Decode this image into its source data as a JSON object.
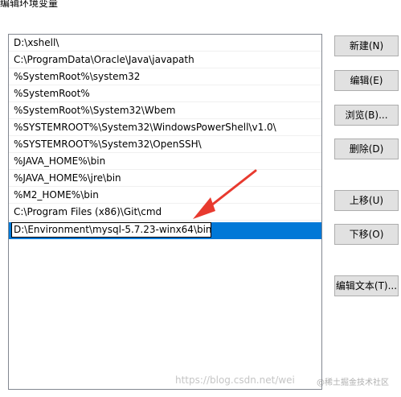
{
  "window": {
    "title": "编辑环境变量"
  },
  "path_list": {
    "items": [
      "D:\\xshell\\",
      "C:\\ProgramData\\Oracle\\Java\\javapath",
      "%SystemRoot%\\system32",
      "%SystemRoot%",
      "%SystemRoot%\\System32\\Wbem",
      "%SYSTEMROOT%\\System32\\WindowsPowerShell\\v1.0\\",
      "%SYSTEMROOT%\\System32\\OpenSSH\\",
      "%JAVA_HOME%\\bin",
      "%JAVA_HOME%\\jre\\bin",
      "%M2_HOME%\\bin",
      "C:\\Program Files (x86)\\Git\\cmd"
    ],
    "editing_value": "D:\\Environment\\mysql-5.7.23-winx64\\bin"
  },
  "buttons": {
    "new": "新建(N)",
    "edit": "编辑(E)",
    "browse": "浏览(B)...",
    "delete": "删除(D)",
    "move_up": "上移(U)",
    "move_down": "下移(O)",
    "edit_text": "编辑文本(T)..."
  },
  "colors": {
    "selection": "#0078d7",
    "arrow": "#e83a2f"
  },
  "watermark": {
    "url": "https://blog.csdn.net/wei",
    "credit": "@稀土掘金技术社区"
  }
}
